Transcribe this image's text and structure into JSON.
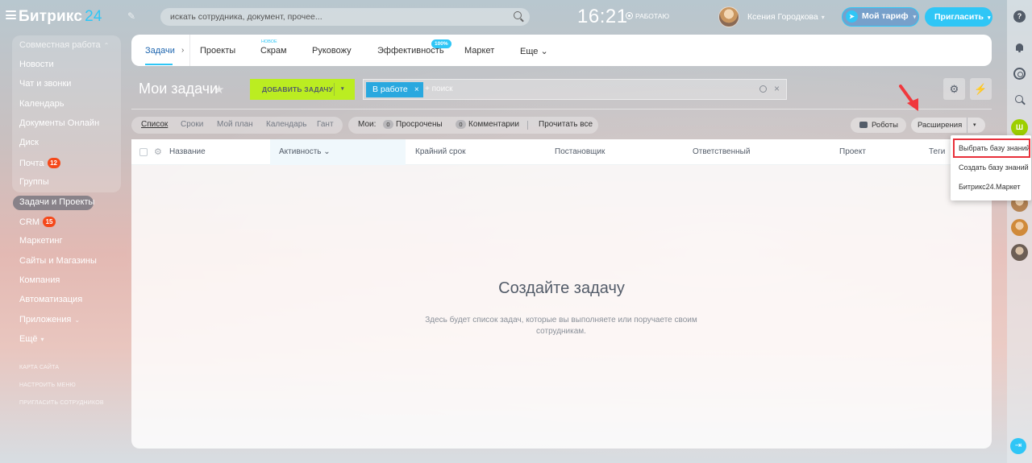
{
  "header": {
    "logo_text": "Битрикс",
    "logo_num": "24",
    "search_placeholder": "искать сотрудника, документ, прочее...",
    "clock": "16:21",
    "work_status": "РАБОТАЮ",
    "user_name": "Ксения Городкова",
    "tariff_label": "Мой тариф",
    "invite_label": "Пригласить"
  },
  "sidebar": {
    "group_title": "Совместная работа",
    "items": [
      {
        "label": "Новости"
      },
      {
        "label": "Чат и звонки"
      },
      {
        "label": "Календарь"
      },
      {
        "label": "Документы Онлайн"
      },
      {
        "label": "Диск"
      },
      {
        "label": "Почта",
        "badge": "12"
      },
      {
        "label": "Группы"
      },
      {
        "label": "Задачи и Проекты"
      },
      {
        "label": "CRM",
        "badge": "15"
      },
      {
        "label": "Маркетинг"
      },
      {
        "label": "Сайты и Магазины"
      },
      {
        "label": "Компания"
      },
      {
        "label": "Автоматизация"
      },
      {
        "label": "Приложения"
      },
      {
        "label": "Ещё"
      }
    ],
    "small_links": [
      "КАРТА САЙТА",
      "НАСТРОИТЬ МЕНЮ",
      "ПРИГЛАСИТЬ СОТРУДНИКОВ"
    ]
  },
  "tabs": {
    "items": [
      "Задачи",
      "Проекты",
      "Скрам",
      "Руковожу",
      "Эффективность",
      "Маркет",
      "Еще"
    ],
    "new_label": "НОВОЕ",
    "efficiency_badge": "100%"
  },
  "page": {
    "title": "Мои задачи",
    "add_task_label": "ДОБАВИТЬ ЗАДАЧУ",
    "filter_tag": "В работе",
    "filter_placeholder": "+ поиск"
  },
  "views": [
    "Список",
    "Сроки",
    "Мой план",
    "Календарь",
    "Гант"
  ],
  "counters": {
    "label": "Мои:",
    "overdue_count": "0",
    "overdue_label": "Просрочены",
    "comments_count": "0",
    "comments_label": "Комментарии",
    "read_all": "Прочитать все"
  },
  "actions": {
    "robots_label": "Роботы",
    "extensions_label": "Расширения"
  },
  "grid": {
    "columns": [
      "Название",
      "Активность",
      "Крайний срок",
      "Постановщик",
      "Ответственный",
      "Проект",
      "Теги"
    ],
    "empty_title": "Создайте задачу",
    "empty_text": "Здесь будет список задач, которые вы выполняете или поручаете своим сотрудникам."
  },
  "popup": {
    "items": [
      "Выбрать базу знаний",
      "Создать базу знаний",
      "Битрикс24.Маркет"
    ]
  },
  "rail": {
    "help_glyph": "?",
    "user_initial": "Ш"
  },
  "colors": {
    "accent": "#2fc6f6",
    "add_task": "#bbed21",
    "badge": "#f54819",
    "highlight_frame": "#e8303a"
  }
}
